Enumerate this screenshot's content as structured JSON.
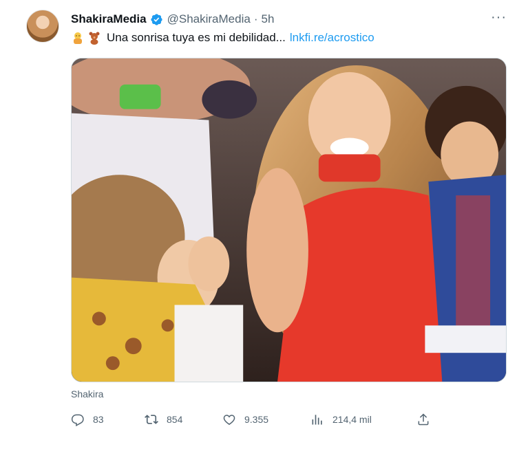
{
  "tweet": {
    "display_name": "ShakiraMedia",
    "handle": "@ShakiraMedia",
    "separator": "·",
    "time": "5h",
    "more_label": "···",
    "emojis": [
      "baby-emoji",
      "teddy-bear-emoji"
    ],
    "text": "Una sonrisa tuya es mi debilidad...",
    "link": "lnkfi.re/acrostico",
    "media_caption": "Shakira",
    "media_description": "Shakira laughing in a red dress beside her sons",
    "icons": {
      "verified": "verified-badge-icon",
      "reply": "reply-icon",
      "retweet": "retweet-icon",
      "like": "heart-icon",
      "views": "views-icon",
      "share": "share-icon"
    },
    "colors": {
      "accent": "#1d9bf0",
      "muted": "#536471",
      "text": "#0f1419"
    }
  },
  "actions": {
    "reply_count": "83",
    "retweet_count": "854",
    "like_count": "9.355",
    "views_count": "214,4 mil"
  }
}
